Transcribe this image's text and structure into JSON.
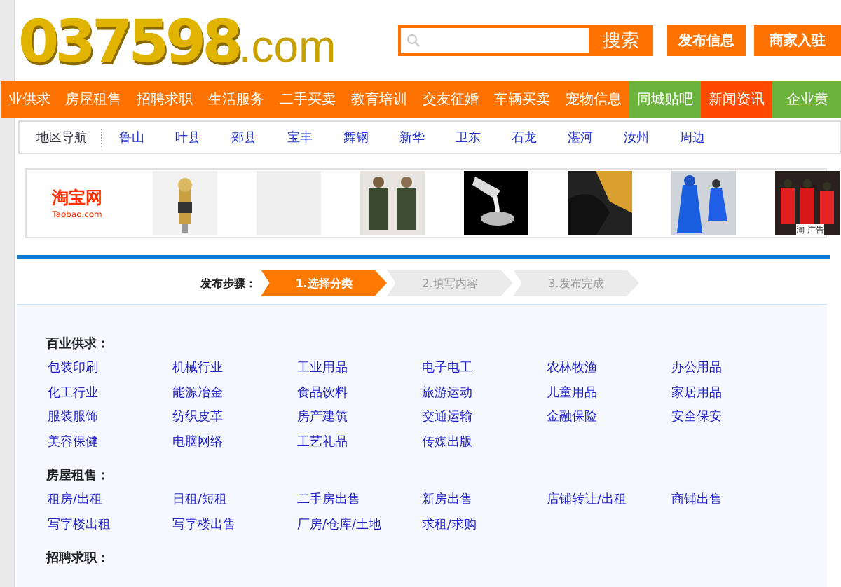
{
  "header": {
    "logo": {
      "number": "037598",
      "domain": ".com"
    },
    "search": {
      "button": "搜索"
    },
    "buttons": [
      "发布信息",
      "商家入驻"
    ]
  },
  "nav": [
    {
      "label": "业供求",
      "kind": "main"
    },
    {
      "label": "房屋租售",
      "kind": "main"
    },
    {
      "label": "招聘求职",
      "kind": "main"
    },
    {
      "label": "生活服务",
      "kind": "main"
    },
    {
      "label": "二手买卖",
      "kind": "main"
    },
    {
      "label": "教育培训",
      "kind": "main"
    },
    {
      "label": "交友征婚",
      "kind": "main"
    },
    {
      "label": "车辆买卖",
      "kind": "main"
    },
    {
      "label": "宠物信息",
      "kind": "main"
    },
    {
      "label": "同城贴吧",
      "kind": "green"
    },
    {
      "label": "新闻资讯",
      "kind": "red"
    },
    {
      "label": "企业黄",
      "kind": "green"
    }
  ],
  "regions": {
    "title": "地区导航",
    "items": [
      "鲁山",
      "叶县",
      "郏县",
      "宝丰",
      "舞钢",
      "新华",
      "卫东",
      "石龙",
      "湛河",
      "汝州",
      "周边"
    ]
  },
  "ad": {
    "logo": "淘宝网",
    "logo_sub": "Taobao.com",
    "items": [
      {
        "kind": "picture"
      },
      {
        "kind": "blank"
      },
      {
        "kind": "picture"
      },
      {
        "kind": "picture"
      },
      {
        "kind": "picture"
      },
      {
        "kind": "picture"
      },
      {
        "kind": "picture"
      }
    ],
    "badge": "淘 广告"
  },
  "steps": {
    "label": "发布步骤：",
    "items": [
      {
        "label": "1.选择分类",
        "selected": true
      },
      {
        "label": "2.填写内容",
        "selected": false
      },
      {
        "label": "3.发布完成",
        "selected": false
      }
    ]
  },
  "categories": [
    {
      "title": "百业供求：",
      "items": [
        "包装印刷",
        "机械行业",
        "工业用品",
        "电子电工",
        "农林牧渔",
        "办公用品",
        "化工行业",
        "能源冶金",
        "食品饮料",
        "旅游运动",
        "儿童用品",
        "家居用品",
        "服装服饰",
        "纺织皮革",
        "房产建筑",
        "交通运输",
        "金融保险",
        "安全保安",
        "美容保健",
        "电脑网络",
        "工艺礼品",
        "传媒出版"
      ]
    },
    {
      "title": "房屋租售：",
      "items": [
        "租房/出租",
        "日租/短租",
        "二手房出售",
        "新房出售",
        "店铺转让/出租",
        "商铺出售",
        "写字楼出租",
        "写字楼出售",
        "厂房/仓库/土地",
        "求租/求购"
      ]
    },
    {
      "title": "招聘求职："
    }
  ]
}
